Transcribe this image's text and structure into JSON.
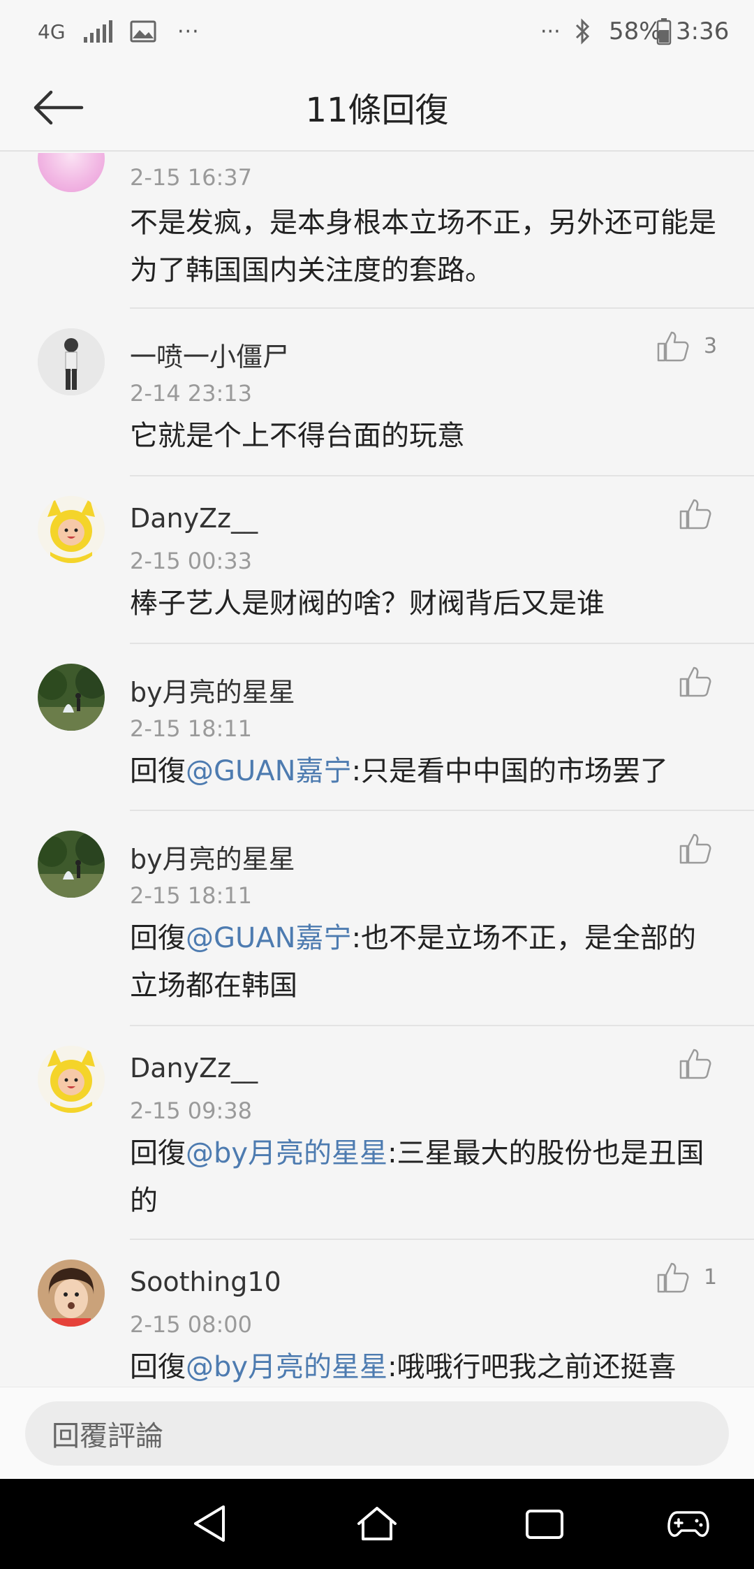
{
  "status_bar": {
    "network": "4G",
    "dots_left": "···",
    "dots_right": "···",
    "battery_text": "58%",
    "time": "3:36"
  },
  "header": {
    "title": "11條回復"
  },
  "comments": [
    {
      "username": "",
      "timestamp": "2-15 16:37",
      "content": "不是发疯，是本身根本立场不正，另外还可能是为了韩国国内关注度的套路。",
      "likes": ""
    },
    {
      "username": "一喷一小僵尸",
      "timestamp": "2-14 23:13",
      "content": "它就是个上不得台面的玩意",
      "likes": "3"
    },
    {
      "username": "DanyZz__",
      "timestamp": "2-15 00:33",
      "content": "棒子艺人是财阀的啥？财阀背后又是谁",
      "likes": ""
    },
    {
      "username": "by月亮的星星",
      "timestamp": "2-15 18:11",
      "reply_prefix": "回復",
      "mention": "@GUAN嘉宁",
      "content": ":只是看中中国的市场罢了",
      "likes": ""
    },
    {
      "username": "by月亮的星星",
      "timestamp": "2-15 18:11",
      "reply_prefix": "回復",
      "mention": "@GUAN嘉宁",
      "content": ":也不是立场不正，是全部的立场都在韩国",
      "likes": ""
    },
    {
      "username": "DanyZz__",
      "timestamp": "2-15 09:38",
      "reply_prefix": "回復",
      "mention": "@by月亮的星星",
      "content": ":三星最大的股份也是丑国的",
      "likes": ""
    },
    {
      "username": "Soothing10",
      "timestamp": "2-15 08:00",
      "reply_prefix": "回復",
      "mention": "@by月亮的星星",
      "content": ":哦哦行吧我之前还挺喜",
      "likes": "1"
    }
  ],
  "reply_bar": {
    "placeholder": "回覆評論"
  },
  "colors": {
    "mention": "#4d7bb0",
    "background": "#f5f5f5",
    "nav_bar": "#000000"
  },
  "icons": [
    "back-arrow-icon",
    "thumbs-up-icon",
    "bluetooth-icon",
    "battery-icon",
    "signal-icon",
    "image-icon",
    "nav-back-icon",
    "nav-home-icon",
    "nav-recents-icon",
    "gamepad-icon"
  ]
}
